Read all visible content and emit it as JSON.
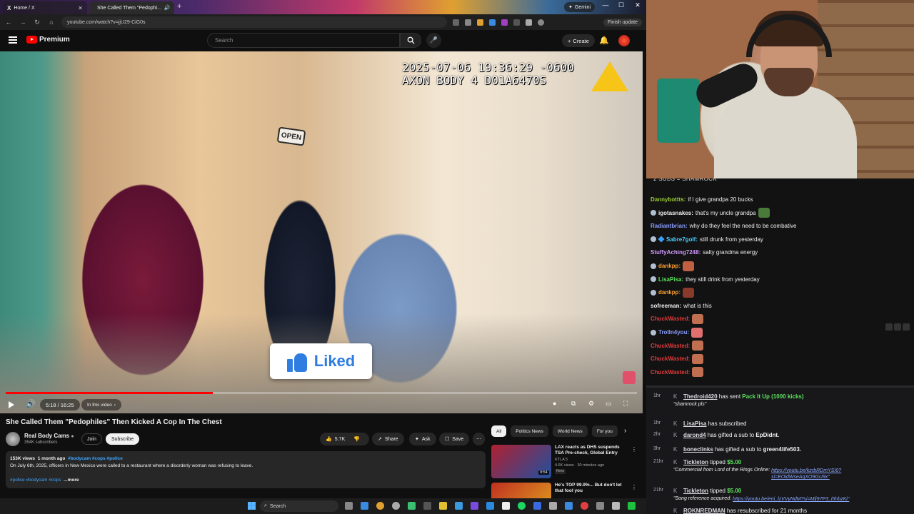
{
  "browser": {
    "tabs": [
      {
        "label": "Home / X",
        "icon": "x-logo-icon"
      },
      {
        "label": "She Called Them \"Pedophi...",
        "icon": "youtube-icon"
      }
    ],
    "gemini_label": "Gemini",
    "url": "youtube.com/watch?v=jjU29-CiG0s",
    "finish_update": "Finish update"
  },
  "youtube": {
    "brand": "Premium",
    "search_placeholder": "Search",
    "create_label": "Create"
  },
  "video": {
    "timestamp_line1": "2025-07-06 19:36:29 -0600",
    "timestamp_line2": "AXON BODY 4 D01A6470S",
    "open_sign": "OPEN",
    "liked_label": "Liked",
    "progress": 0.3283,
    "time": "5:18 / 16:25",
    "chapter": "In this video",
    "title": "She Called Them \"Pedophiles\" Then Kicked A Cop In The Chest"
  },
  "channel": {
    "name": "Real Body Cams",
    "subs": "354K subscribers",
    "join": "Join",
    "subscribe": "Subscribe"
  },
  "actions": {
    "likes": "5.7K",
    "share": "Share",
    "ask": "Ask",
    "save": "Save"
  },
  "description": {
    "views": "153K views",
    "age": "1 month ago",
    "tags": "#bodycam #cops #police",
    "text": "On July 6th, 2025, officers in New Mexico were called to a restaurant where a disorderly woman was refusing to leave.",
    "bottom_tags": "#police #bodycam #cops",
    "more": "...more"
  },
  "chips": [
    "All",
    "Politics News",
    "World News",
    "For you"
  ],
  "recommendations": [
    {
      "title": "LAX reacts as DHS suspends TSA Pre-check, Global Entry",
      "channel": "KTLA 5",
      "meta": "4.6K views · 30 minutes ago",
      "badge": "New",
      "duration": "9:54",
      "color1": "#b02030",
      "color2": "#2050a0"
    },
    {
      "title": "He's TOP 99.9%... But don't let that fool you",
      "channel": "",
      "meta": "",
      "badge": "",
      "duration": "",
      "color1": "#c03020",
      "color2": "#e0a020"
    }
  ],
  "chat": {
    "banner": "2 SUBS = SHAMROCK",
    "messages": [
      {
        "user": "Dannybottts",
        "color": "#9acd32",
        "text": "if I give grandpa 20 bucks",
        "badge": "",
        "emote": ""
      },
      {
        "user": "igotasnakes",
        "color": "#efeff1",
        "text": "that's my uncle grandpa",
        "badge": "dot",
        "emote": "#4a7a3a"
      },
      {
        "user": "Radiantbrian",
        "color": "#8a9cff",
        "text": "why do they feel the need to be combative",
        "badge": "",
        "emote": ""
      },
      {
        "user": "Sabre7golf",
        "color": "#4ad0ff",
        "text": "still drunk from yesterday",
        "badge": "dot2",
        "emote": ""
      },
      {
        "user": "StuffyAching7248",
        "color": "#d09aff",
        "text": "salty grandma energy",
        "badge": "",
        "emote": ""
      },
      {
        "user": "dankpp",
        "color": "#ffa030",
        "text": "",
        "badge": "dot",
        "emote": "#c06040"
      },
      {
        "user": "LisaPisa",
        "color": "#5ce45c",
        "text": "they still drink from yesterday",
        "badge": "dot",
        "emote": ""
      },
      {
        "user": "dankpp",
        "color": "#ffa030",
        "text": "",
        "badge": "dot",
        "emote": "#8a3a2a"
      },
      {
        "user": "sofreeman",
        "color": "#efeff1",
        "text": "what is this",
        "badge": "",
        "emote": ""
      },
      {
        "user": "ChuckWasted",
        "color": "#e03a3a",
        "text": "",
        "badge": "",
        "emote": "#c07050"
      },
      {
        "user": "Trolln4you",
        "color": "#8a9cff",
        "text": "",
        "badge": "dot",
        "emote": "#e07070"
      },
      {
        "user": "ChuckWasted",
        "color": "#e03a3a",
        "text": "",
        "badge": "",
        "emote": "#c07050"
      },
      {
        "user": "ChuckWasted",
        "color": "#e03a3a",
        "text": "",
        "badge": "",
        "emote": "#c07050"
      },
      {
        "user": "ChuckWasted",
        "color": "#e03a3a",
        "text": "",
        "badge": "",
        "emote": "#c07050"
      }
    ]
  },
  "feed": {
    "events": [
      {
        "time": "1hr",
        "user": "Thedroid420",
        "pre": " has sent ",
        "hl": "Pack It Up (1000 kicks)",
        "post": "",
        "line2": "\"shamrock pls\"",
        "link": ""
      },
      {
        "time": "1hr",
        "user": "LisaPisa",
        "pre": " has subscribed",
        "hl": "",
        "post": "",
        "line2": "",
        "link": ""
      },
      {
        "time": "2hr",
        "user": "darond4",
        "pre": " has gifted a sub to ",
        "hl": "",
        "post": "EpDidnt.",
        "line2": "",
        "link": ""
      },
      {
        "time": "3hr",
        "user": "boneclinks",
        "pre": " has gifted a sub to ",
        "hl": "",
        "post": "green4life503.",
        "line2": "",
        "link": ""
      },
      {
        "time": "21hr",
        "user": "Tickleton",
        "pre": " tipped ",
        "hl": "$5.00",
        "post": "",
        "line2": "\"Commercial from Lord of the Rings Online: ",
        "link": "https://youtu.be/kzrbRDmYSI0?si=EOidWseAqXO9GU9x\""
      },
      {
        "time": "21hr",
        "user": "Tickleton",
        "pre": " tipped ",
        "hl": "$5.00",
        "post": "",
        "line2": "\"Song reference acquired: ",
        "link": "https://youtu.be/eni_lzVVyNdM?si=Mlj97P3_i5hbzKi\""
      },
      {
        "time": "",
        "user": "ROKNREDMAN",
        "pre": " has resubscribed for 21 months",
        "hl": "",
        "post": "",
        "line2": "",
        "link": ""
      }
    ]
  },
  "taskbar": {
    "search": "Search"
  }
}
